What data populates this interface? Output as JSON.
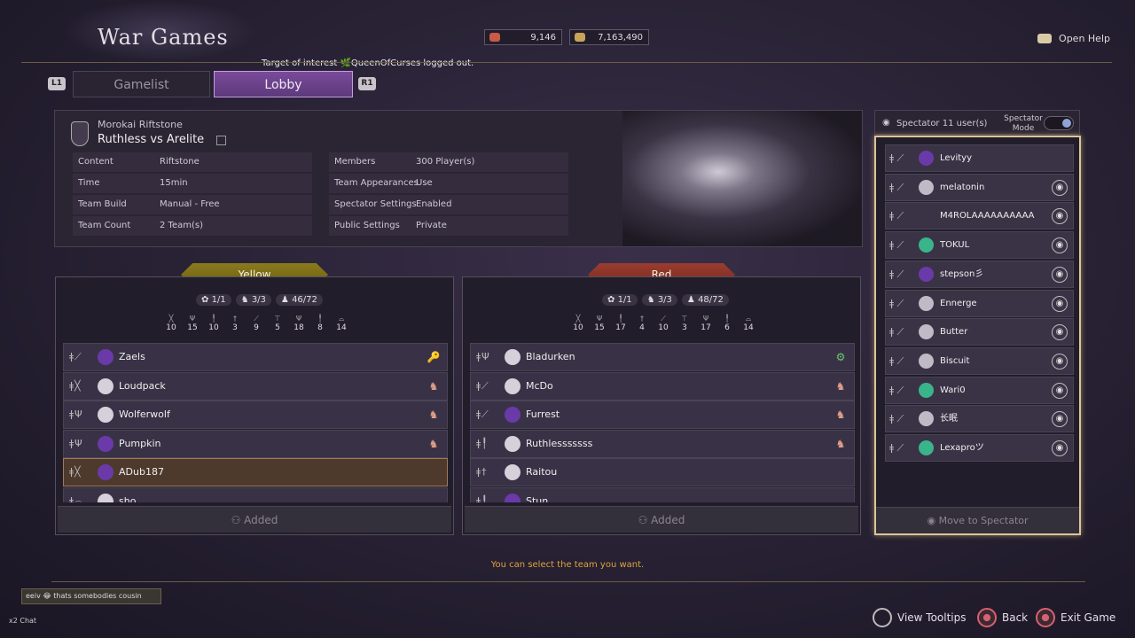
{
  "header": {
    "title": "War Games",
    "currency1": "9,146",
    "currency2": "7,163,490",
    "open_help": "Open Help",
    "toast": "Target of interest 🌿QueenOfCurses logged out."
  },
  "tabs": {
    "l1": "L1",
    "r1": "R1",
    "gamelist": "Gamelist",
    "lobby": "Lobby"
  },
  "match": {
    "mode": "Morokai Riftstone",
    "name": "Ruthless vs Arelite",
    "left": [
      {
        "k": "Content",
        "v": "Riftstone"
      },
      {
        "k": "Time",
        "v": "15min"
      },
      {
        "k": "Team Build",
        "v": "Manual - Free"
      },
      {
        "k": "Team Count",
        "v": "2 Team(s)"
      }
    ],
    "right": [
      {
        "k": "Members",
        "v": "300 Player(s)"
      },
      {
        "k": "Team Appearances",
        "v": "Use"
      },
      {
        "k": "Spectator Settings",
        "v": "Enabled"
      },
      {
        "k": "Public Settings",
        "v": "Private"
      }
    ]
  },
  "yellow": {
    "name": "Yellow",
    "stats": [
      "1/1",
      "3/3",
      "46/72"
    ],
    "counts": [
      "10",
      "15",
      "10",
      "3",
      "9",
      "5",
      "18",
      "8",
      "14"
    ],
    "players": [
      "Zaels",
      "Loudpack",
      "Wolferwolf",
      "Pumpkin",
      "ADub187",
      "sho"
    ],
    "added": "Added"
  },
  "red": {
    "name": "Red",
    "stats": [
      "1/1",
      "3/3",
      "48/72"
    ],
    "counts": [
      "10",
      "15",
      "17",
      "4",
      "10",
      "3",
      "17",
      "6",
      "14"
    ],
    "players": [
      "Bladurken",
      "McDo",
      "Furrest",
      "Ruthlesssssss",
      "Raitou",
      "Stun"
    ],
    "added": "Added"
  },
  "spectator": {
    "header": "Spectator 11 user(s)",
    "mode_label": "Spectator Mode",
    "users": [
      "Levityy",
      "melatonin",
      "M4ROLAAAAAAAAAA",
      "TOKUL",
      "stepson彡",
      "Ennerge",
      "Butter",
      "Biscuit",
      "Wari0",
      "长眠",
      "Lexaproツ"
    ],
    "move": "Move to Spectator"
  },
  "hint": "You can select the team you want.",
  "chat": {
    "msg": "eeiv 😂 thats somebodies cousin",
    "label": "x2 Chat"
  },
  "footer": {
    "tooltips": "View Tooltips",
    "back": "Back",
    "exit": "Exit Game"
  },
  "colors": {
    "accent": "#dcc596",
    "lobby_tab": "#6a4290",
    "yellow": "#8a7a1e",
    "red": "#9a3d30",
    "hint": "#e0a23c"
  }
}
